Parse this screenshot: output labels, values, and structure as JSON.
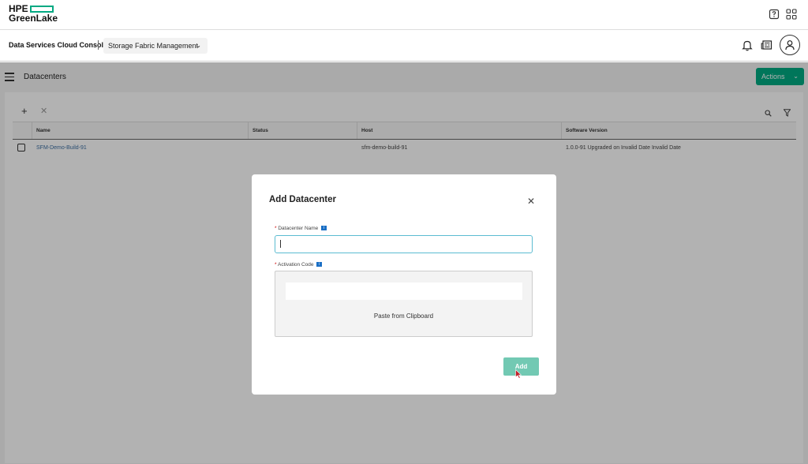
{
  "brand": {
    "line1": "HPE",
    "line2": "GreenLake",
    "accent": "#01a982"
  },
  "header": {
    "console_title": "Data Services Cloud Console",
    "app_selector": "Storage Fabric Management",
    "icons": [
      "help-icon",
      "apps-grid-icon",
      "bell-icon",
      "news-icon",
      "user-avatar-icon"
    ]
  },
  "page": {
    "title": "Datacenters",
    "actions_label": "Actions",
    "toolbar_icons": [
      "add-icon",
      "delete-icon",
      "search-icon",
      "filter-icon"
    ]
  },
  "table": {
    "columns": [
      "Name",
      "Status",
      "Host",
      "Software Version"
    ],
    "rows": [
      {
        "name": "SFM-Demo-Build-91",
        "status": "",
        "host": "sfm-demo-build-91",
        "software_version": "1.0.0-91 Upgraded on Invalid Date Invalid Date"
      }
    ]
  },
  "modal": {
    "title": "Add Datacenter",
    "name_label": "Datacenter Name",
    "name_value": "",
    "code_label": "Activation Code",
    "paste_label": "Paste from Clipboard",
    "add_label": "Add",
    "required_marker": "*",
    "info_glyph": "i"
  }
}
